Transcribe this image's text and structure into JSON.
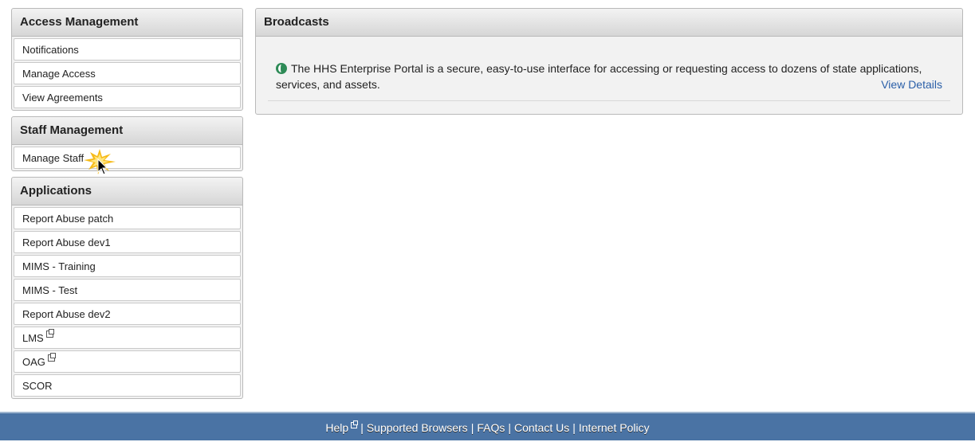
{
  "sidebar": {
    "access_management": {
      "title": "Access Management",
      "items": [
        "Notifications",
        "Manage Access",
        "View Agreements"
      ]
    },
    "staff_management": {
      "title": "Staff Management",
      "items": [
        "Manage Staff"
      ]
    },
    "applications": {
      "title": "Applications",
      "items": [
        "Report Abuse patch",
        "Report Abuse dev1",
        "MIMS - Training",
        "MIMS - Test",
        "Report Abuse dev2",
        "LMS",
        "OAG",
        "SCOR"
      ]
    }
  },
  "broadcasts": {
    "title": "Broadcasts",
    "icon": "globe-icon",
    "message": "The HHS Enterprise Portal is a secure, easy-to-use interface for accessing or requesting access to dozens of state applications, services, and assets.",
    "view_details": "View Details"
  },
  "footer": {
    "help": "Help",
    "supported_browsers": "Supported Browsers",
    "faqs": "FAQs",
    "contact_us": "Contact Us",
    "internet_policy": "Internet Policy",
    "separator": "|"
  },
  "colors": {
    "footer_bg": "#4a73a4",
    "link": "#2a5fa8",
    "panel_bg": "#f2f2f2"
  }
}
